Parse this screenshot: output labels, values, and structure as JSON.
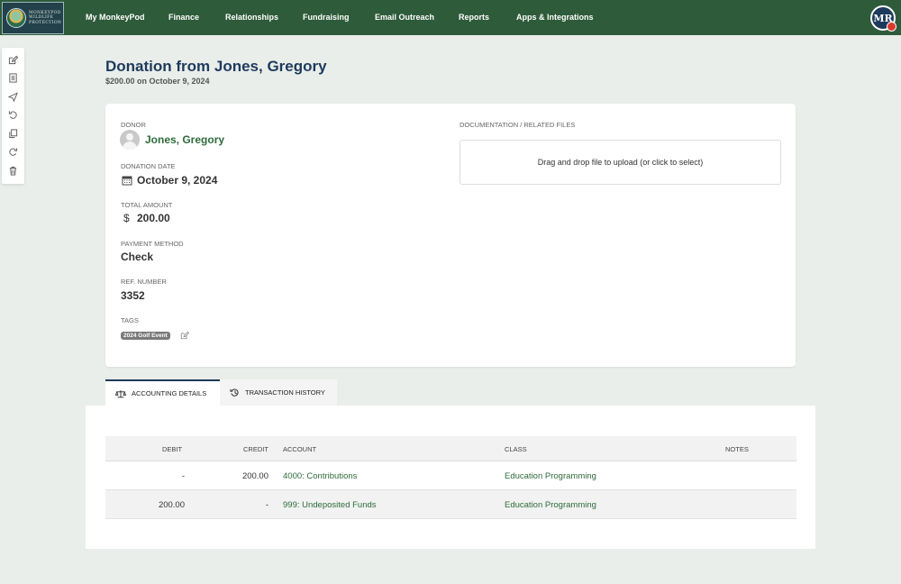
{
  "org": {
    "logo_text": [
      "MONKEYPOD",
      "WILDLIFE",
      "PROTECTION"
    ]
  },
  "nav": {
    "items": [
      "My MonkeyPod",
      "Finance",
      "Relationships",
      "Fundraising",
      "Email Outreach",
      "Reports",
      "Apps & Integrations"
    ],
    "user_initials": "MR"
  },
  "toolbar": {
    "icons": [
      "edit-icon",
      "document-icon",
      "send-icon",
      "undo-icon",
      "copy-icon",
      "redo-icon",
      "trash-icon"
    ]
  },
  "header": {
    "title": "Donation from Jones, Gregory",
    "subtitle": "$200.00 on October 9, 2024"
  },
  "details": {
    "donor_label": "DONOR",
    "donor_name": "Jones, Gregory",
    "date_label": "DONATION DATE",
    "date_value": "October 9, 2024",
    "amount_label": "TOTAL AMOUNT",
    "amount_currency": "$",
    "amount_value": "200.00",
    "payment_label": "PAYMENT METHOD",
    "payment_value": "Check",
    "ref_label": "REF. NUMBER",
    "ref_value": "3352",
    "tags_label": "TAGS",
    "tags": [
      "2024 Golf Event"
    ]
  },
  "files": {
    "label": "DOCUMENTATION / RELATED FILES",
    "dropzone_text": "Drag and drop file to upload (or click to select)"
  },
  "tabs": [
    {
      "label": "ACCOUNTING DETAILS",
      "active": true
    },
    {
      "label": "TRANSACTION HISTORY",
      "active": false
    }
  ],
  "table": {
    "headers": [
      "DEBIT",
      "CREDIT",
      "ACCOUNT",
      "CLASS",
      "NOTES"
    ],
    "rows": [
      {
        "debit": "-",
        "credit": "200.00",
        "account": "4000: Contributions",
        "class": "Education Programming",
        "notes": ""
      },
      {
        "debit": "200.00",
        "credit": "-",
        "account": "999: Undeposited Funds",
        "class": "Education Programming",
        "notes": ""
      }
    ]
  },
  "colors": {
    "nav": "#2e5b3a",
    "title": "#1e3a5c",
    "link": "#2e6b3a",
    "background": "#e9eeea"
  }
}
